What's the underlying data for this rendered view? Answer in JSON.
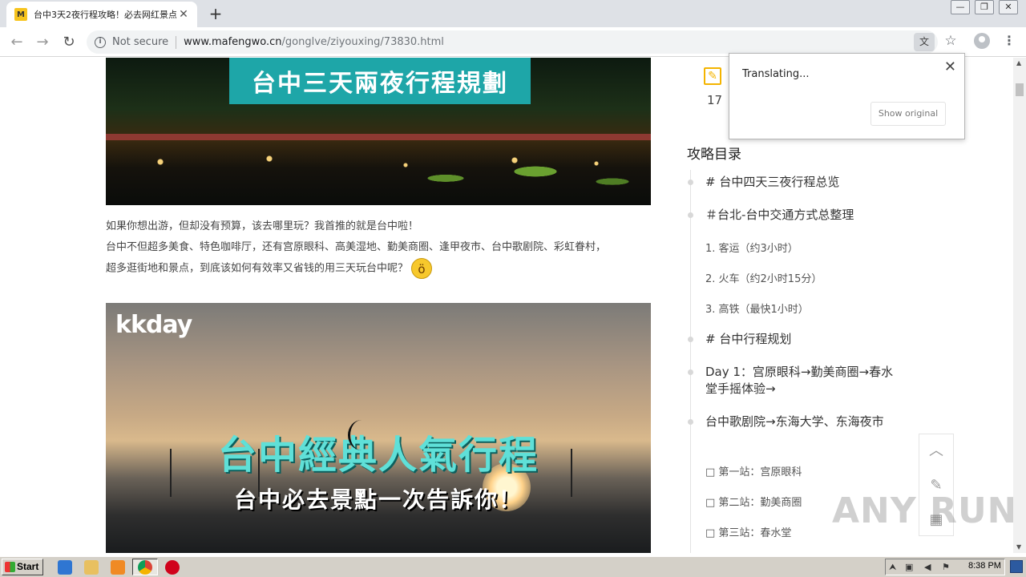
{
  "browser": {
    "tab_title": "台中3天2夜行程攻略！必去网红景点",
    "favicon_glyph": "M",
    "new_tab": "+",
    "security_label": "Not secure",
    "url_host": "www.mafengwo.cn",
    "url_path": "/gonglve/ziyouxing/73830.html",
    "window_controls": [
      "—",
      "❐",
      "✕"
    ]
  },
  "translate_popup": {
    "status": "Translating...",
    "button": "Show original"
  },
  "article": {
    "hero1_banner": "台中三天兩夜行程規劃",
    "intro_line1": "如果你想出游，但却没有预算，该去哪里玩？我首推的就是台中啦！",
    "intro_line2": "台中不但超多美食、特色咖啡厅，还有宫原眼科、高美湿地、勤美商圈、逢甲夜市、台中歌剧院、彩虹眷村，",
    "intro_line3": "超多逛街地和景点，到底该如何有效率又省钱的用三天玩台中呢？",
    "hero2_logo": "kkday",
    "hero2_title": "台中經典人氣行程",
    "hero2_subtitle": "台中必去景點一次告訴你！"
  },
  "sidebar": {
    "edit_count": "17",
    "toc_title": "攻略目录",
    "toc": [
      {
        "label": "# 台中四天三夜行程总览"
      },
      {
        "label": "＃台北-台中交通方式总整理"
      },
      {
        "label": "1. 客运（约3小时）"
      },
      {
        "label": "2. 火车（约2小时15分）"
      },
      {
        "label": "3. 高铁（最快1小时）"
      },
      {
        "label": "# 台中行程规划"
      },
      {
        "label": "Day 1：宫原眼科→勤美商圈→春水堂手摇体验→"
      },
      {
        "label": "台中歌剧院→东海大学、东海夜市"
      },
      {
        "label": "□ 第一站：宫原眼科"
      },
      {
        "label": "□ 第二站：勤美商圈"
      },
      {
        "label": "□ 第三站：春水堂"
      }
    ]
  },
  "watermark": "ANY RUN",
  "taskbar": {
    "start_label": "Start",
    "clock": "8:38 PM"
  },
  "colors": {
    "accent_yellow": "#f4b400",
    "banner_teal": "#1ea6a8"
  }
}
